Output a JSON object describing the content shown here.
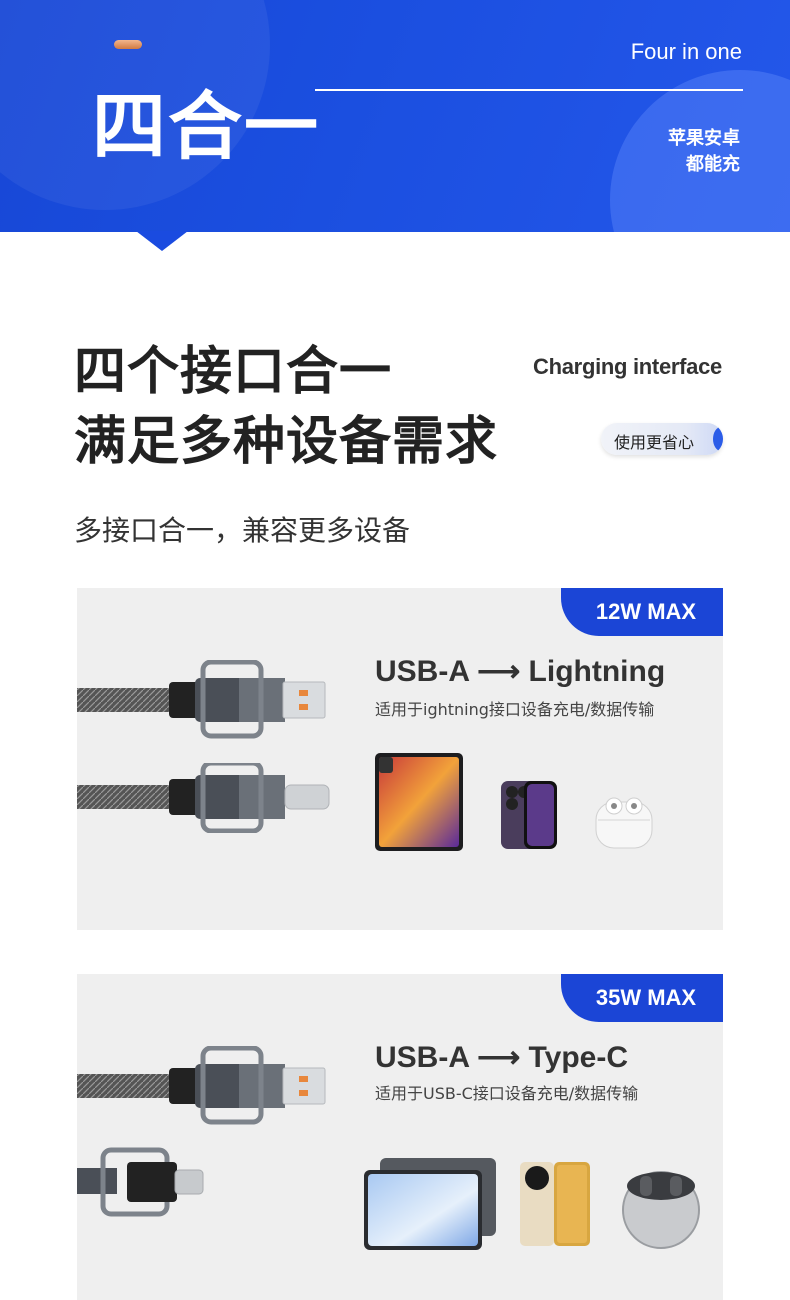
{
  "banner": {
    "title": "四合一",
    "subtitle_en": "Four in one",
    "subtitle_line1": "苹果安卓",
    "subtitle_line2": "都能充"
  },
  "heading": {
    "line1": "四个接口合一",
    "line2": "满足多种设备需求",
    "tag_en": "Charging interface",
    "tag_pill": "使用更省心",
    "description": "多接口合一，兼容更多设备"
  },
  "cards": [
    {
      "badge": "12W MAX",
      "title": "USB-A ⟶ Lightning",
      "description": "适用于ightning接口设备充电/数据传输",
      "devices": [
        "tablet-icon",
        "phone-icon",
        "earbuds-icon"
      ]
    },
    {
      "badge": "35W MAX",
      "title": "USB-A ⟶ Type-C",
      "description": "适用于USB-C接口设备充电/数据传输",
      "devices": [
        "tablet-icon",
        "phone-icon",
        "earbuds-icon"
      ]
    }
  ],
  "colors": {
    "brand_blue": "#1b45d6",
    "card_bg": "#efefef",
    "text": "#222222"
  }
}
